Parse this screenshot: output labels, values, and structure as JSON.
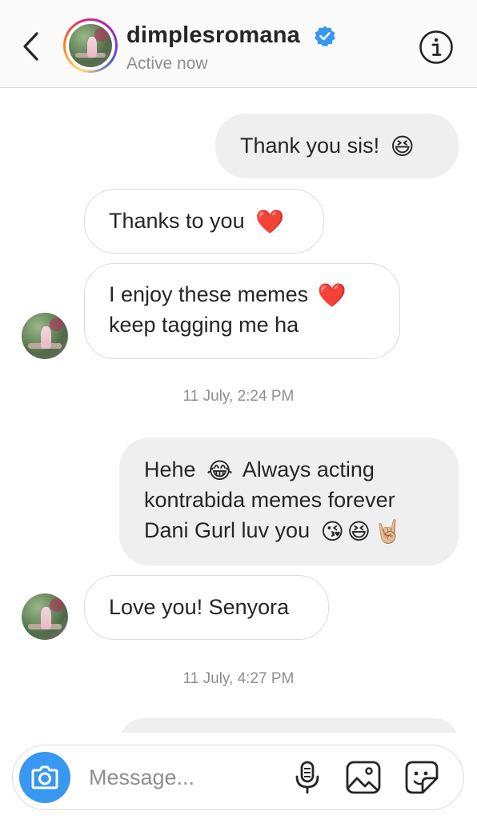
{
  "header": {
    "username": "dimplesromana",
    "status": "Active now"
  },
  "messages": [
    {
      "direction": "out",
      "text": "Thank you sis!",
      "emoji": "😆"
    },
    {
      "direction": "in",
      "text": "Thanks to you",
      "emoji": "❤️"
    },
    {
      "direction": "in",
      "line1": "I enjoy these memes",
      "emoji": "❤️",
      "line2": "keep tagging me ha"
    },
    {
      "type": "timestamp",
      "text": "11 July, 2:24 PM"
    },
    {
      "direction": "out",
      "line1_a": "Hehe",
      "line1_emoji": "😂",
      "line1_b": "Always acting",
      "line2": "kontrabida memes forever",
      "line3": "Dani Gurl luv you",
      "line3_emojis": "😘😆🤘🏼"
    },
    {
      "direction": "in",
      "text": "Love you! Senyora"
    },
    {
      "type": "timestamp",
      "text": "11 July, 4:27 PM"
    }
  ],
  "composer": {
    "placeholder": "Message..."
  },
  "icons": {
    "back": "chevron-left-icon",
    "verified": "verified-badge-icon",
    "info": "info-icon",
    "camera": "camera-icon",
    "mic": "microphone-icon",
    "gallery": "image-icon",
    "sticker": "sticker-icon"
  },
  "colors": {
    "accent": "#3897f0",
    "verified": "#3897f0",
    "outgoing_bubble": "#efefef",
    "secondary_text": "#8e8e8e"
  }
}
